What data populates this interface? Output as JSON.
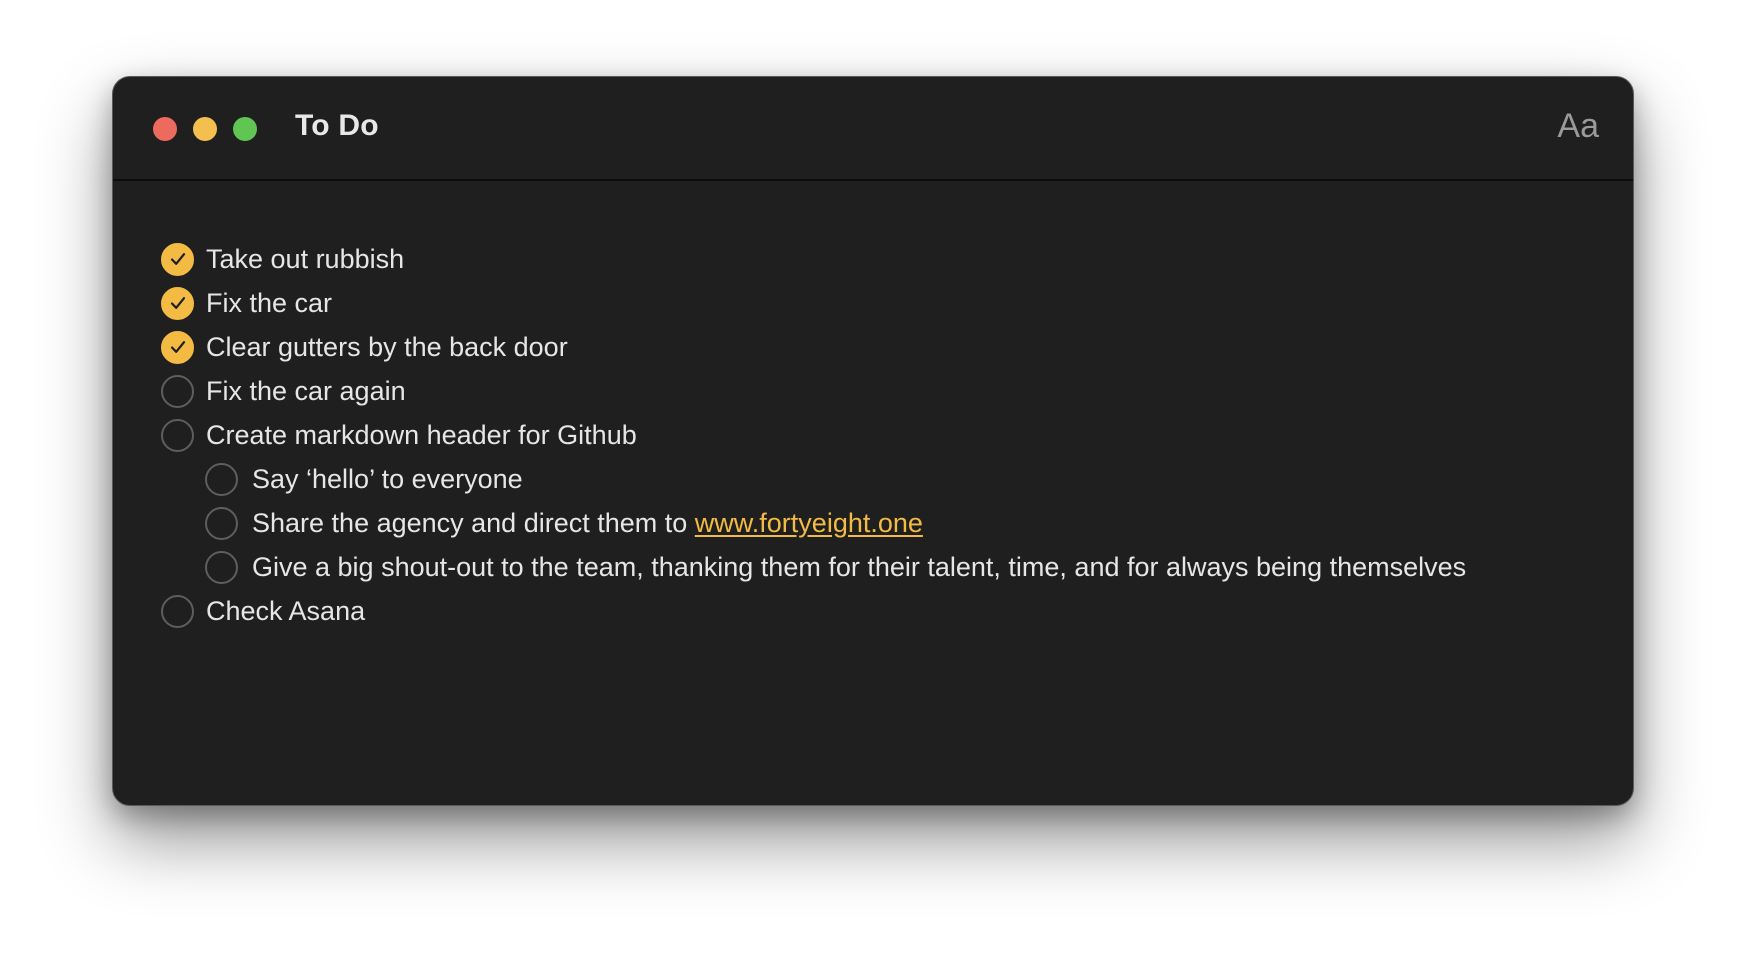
{
  "window": {
    "title": "To Do",
    "font_button_label": "Aa"
  },
  "colors": {
    "window_bg": "#1f1f1f",
    "accent": "#f3bb44",
    "close": "#ed6a5e",
    "minimize": "#f5bf4f",
    "zoom": "#61c554"
  },
  "icons": {
    "close": "close-window-icon",
    "minimize": "minimize-window-icon",
    "zoom": "zoom-window-icon",
    "check": "checkmark-icon"
  },
  "todos": [
    {
      "text": "Take out rubbish",
      "checked": true,
      "indent": 0
    },
    {
      "text": "Fix the car",
      "checked": true,
      "indent": 0
    },
    {
      "text": "Clear gutters by the back door",
      "checked": true,
      "indent": 0
    },
    {
      "text": "Fix the car again",
      "checked": false,
      "indent": 0
    },
    {
      "text": "Create markdown header for Github",
      "checked": false,
      "indent": 0
    },
    {
      "text": "Say ‘hello’ to everyone",
      "checked": false,
      "indent": 1
    },
    {
      "text": "Share the agency and direct them to ",
      "link_text": "www.fortyeight.one",
      "checked": false,
      "indent": 1
    },
    {
      "text": "Give a big shout-out to the team, thanking them for their talent, time, and for always being themselves",
      "checked": false,
      "indent": 1
    },
    {
      "text": "Check Asana",
      "checked": false,
      "indent": 0
    }
  ]
}
